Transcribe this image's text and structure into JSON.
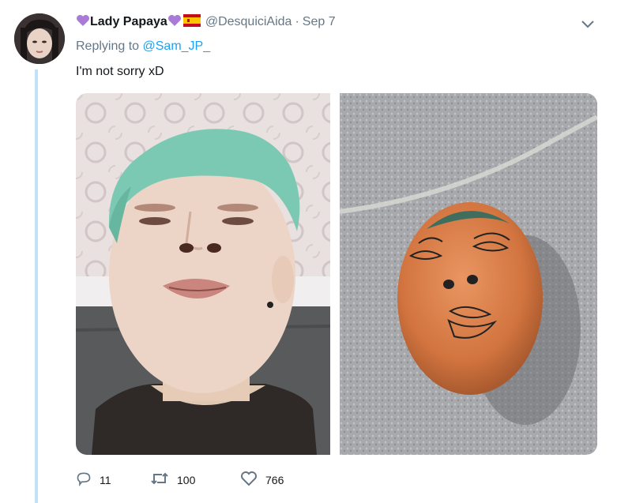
{
  "tweet": {
    "display_name": "Lady Papaya",
    "handle": "@DesquiciAida",
    "separator": "·",
    "date": "Sep 7",
    "replying_prefix": "Replying to",
    "replying_handle": "@Sam_JP_",
    "text": "I'm not sorry xD",
    "emoji": [
      "purple-heart",
      "purple-heart",
      "spain-flag"
    ]
  },
  "media": {
    "images": [
      {
        "name": "person-selfie-photo"
      },
      {
        "name": "egg-with-drawn-face-photo"
      }
    ]
  },
  "actions": {
    "replies": "11",
    "retweets": "100",
    "likes": "766"
  },
  "colors": {
    "link": "#1da1f2",
    "muted": "#657786",
    "thread_line": "#bfe2f8",
    "emoji_heart": "#a97bd6"
  }
}
